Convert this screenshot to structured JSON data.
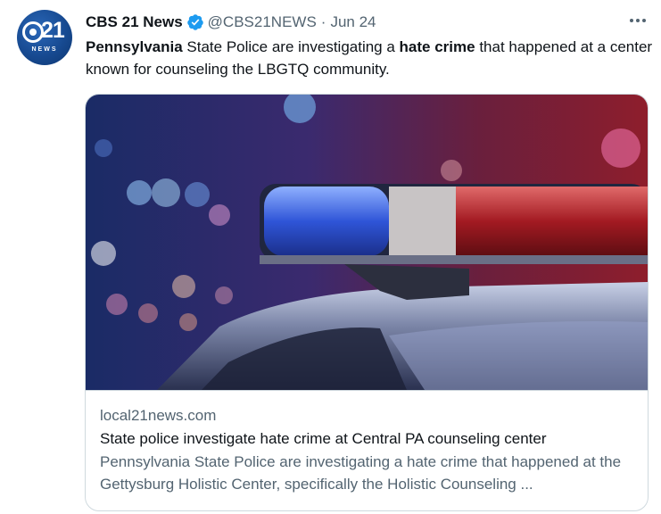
{
  "tweet": {
    "author_name": "CBS 21 News",
    "handle": "@CBS21NEWS",
    "separator": "·",
    "date": "Jun 24",
    "text_segments": {
      "s1": "Pennsylvania",
      "s2": " State Police are investigating a ",
      "s3": "hate crime",
      "s4": " that happened at a center known for counseling the LBGTQ community."
    }
  },
  "avatar": {
    "logo_number": "21",
    "logo_subtext": "NEWS",
    "color": "#174a91"
  },
  "card": {
    "domain": "local21news.com",
    "title": "State police investigate hate crime at Central PA counseling center",
    "description": "Pennsylvania State Police are investigating a hate crime that happened at the Gettysburg Holistic Center, specifically the Holistic Counseling ...",
    "image_subject": "police-light-bar-on-car"
  },
  "icons": {
    "verified": "verified-badge-icon",
    "more": "more-options-icon"
  },
  "colors": {
    "text": "#0f1419",
    "secondary": "#536471",
    "verified": "#1d9bf0",
    "border": "#cfd9de"
  }
}
